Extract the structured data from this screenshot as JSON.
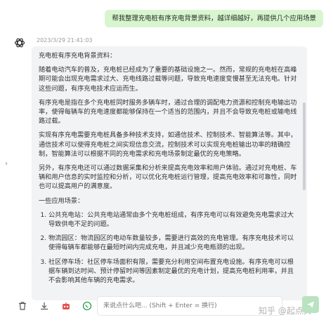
{
  "user_message": "帮我整理充电桩有序充电背景资料，越详细越好，再提供几个应用场景",
  "timestamp": "2023/3/29 21:41:03",
  "response": {
    "heading": "充电桩有序充电背景资料：",
    "paragraphs": [
      "随着电动汽车的普及，充电桩已经成为了重要的基础设施之一。然而，常规的充电桩在高峰期可能会出现充电需求过大、充电线路过载等问题，导致充电速度变慢甚至无法充电。针对这些问题，有序充电技术应运而生。",
      "有序充电是指在多个充电桩同时服务多辆车时，通过合理的调配电力资源和控制充电输出功率，使得每辆车的充电速度都能够保持在一个适当的范围内，并且不会导致充电桩或输电线路过载。",
      "实现有序充电需要充电桩具备多种技术支持，如通信技术、控制技术、智能算法等。其中，通信技术可以使得充电桩之间实现信息交流，控制技术可以实现充电桩输出功率的精确控制，智能算法可以根据不同的充电需求和充电场景制定最优的充电策略。",
      "另外，有序充电还可以通过数据采集和分析来提高充电效率和用户体验。通过对充电桩、车辆和用户信息的实时监控和分析，可以优化充电桩运行管理，提高充电效率和可靠性，同时也可以提高用户的满意度。",
      "一些应用场景："
    ],
    "scenarios": [
      "公共充电站：公共充电站通常由多个充电桩组成，有序充电可以有效避免充电需求过大导致供电不足的问题。",
      "物流园区：物流园区的电动车数量较多，需要进行高效的充电管理。有序充电技术可以使得每辆车都能够在最短时间内完成充电，并且减少充电瓶颈的出现。",
      "社区停车场：社区停车场面积有限，需要充分利用空间布置充电设施。有序充电可以根据车辆到达时间、预计停留时间等因素制定最优的充电计划，提高充电桩利用率，并且不会影响其他车辆的充电需求。"
    ]
  },
  "input": {
    "placeholder": "来说点什么吧... (Shift + Enter = 换行)"
  },
  "toolbar": {
    "icons": [
      "trash-icon",
      "download-icon",
      "robot-icon",
      "whatsapp-icon"
    ]
  },
  "watermark": "知乎 @起点贝",
  "colors": {
    "user_bubble": "#d8f5d0",
    "response_card": "#f2f3f5",
    "send_button": "#b9e3c0"
  }
}
